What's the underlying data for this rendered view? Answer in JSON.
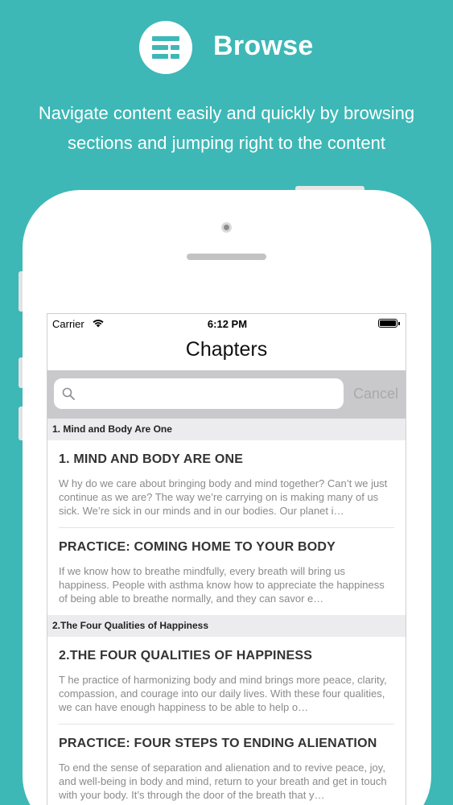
{
  "header": {
    "icon": "list-icon",
    "title": "Browse",
    "subtitle": "Navigate content easily and quickly by browsing sections and jumping right to the content"
  },
  "status_bar": {
    "carrier": "Carrier",
    "time": "6:12 PM",
    "icons": [
      "wifi-icon",
      "battery-icon"
    ]
  },
  "nav": {
    "title": "Chapters"
  },
  "search": {
    "placeholder": "",
    "cancel_label": "Cancel",
    "icon": "search-icon"
  },
  "sections": [
    {
      "header": "1. Mind and Body Are One",
      "rows": [
        {
          "title": "1. MIND AND BODY ARE ONE",
          "body": "W hy do we care about bringing body and mind together? Can’t we just continue as we are? The way we’re carrying on is making many of us sick. We’re sick in our minds and in our bodies. Our planet i…"
        },
        {
          "title": "PRACTICE: COMING HOME TO YOUR BODY",
          "body": "If we know how to breathe mindfully, every breath will bring us happiness. People with asthma know how to appreciate the happiness of being able to breathe normally, and they can savor e…"
        }
      ]
    },
    {
      "header": "2.The Four Qualities of Happiness",
      "rows": [
        {
          "title": "2.THE FOUR QUALITIES OF HAPPINESS",
          "body": "T he practice of harmonizing body and mind brings more peace, clarity, compassion, and courage into our daily lives. With these four qualities, we can have enough happiness to be able to help o…"
        },
        {
          "title": "PRACTICE: FOUR STEPS TO ENDING ALIENATION",
          "body": "To end the sense of separation and alienation and to revive peace, joy, and well-being in body and mind, return to your breath and get in touch with your body. It’s through the door of the breath that y…"
        }
      ]
    }
  ]
}
